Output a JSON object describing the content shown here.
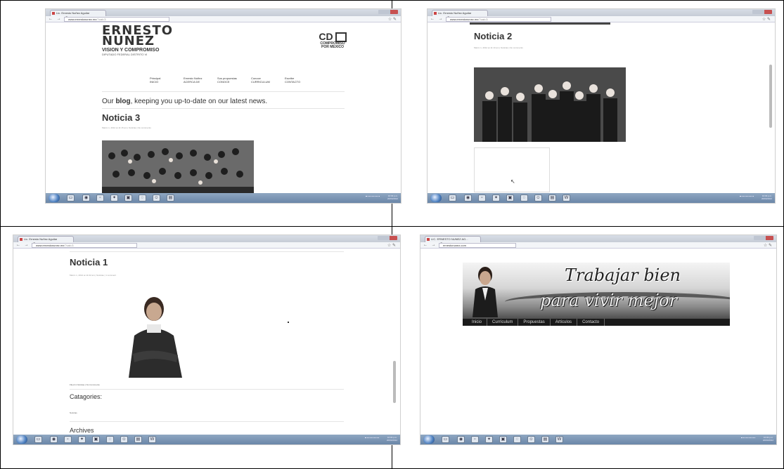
{
  "common": {
    "nav_buttons": "← → C",
    "tools": "☆ ✎",
    "tray_time": "10:03 p.m.",
    "tray_date": "20/04/2012"
  },
  "shot1": {
    "tab_title": "Lic. Ernesto Nuñez Aguilar",
    "url": "www.ernestonunez.mx",
    "url_path": "/?cat=3",
    "logo_top": "ERNESTO",
    "logo_mid": "NUNEZ",
    "logo_slogan": "VISION Y COMPROMISO",
    "logo_sub": "DIPUTADO FEDERAL DISTRITO VI",
    "party_marks": "CD",
    "party_line1": "COMPROMISO",
    "party_line2": "POR MEXICO",
    "menu": [
      {
        "top": "Principal",
        "bottom": "INICIO"
      },
      {
        "top": "Ernesto Nuñez",
        "bottom": "ACERCA DE"
      },
      {
        "top": "Sus propuestas",
        "bottom": "CONOCE"
      },
      {
        "top": "Conoce",
        "bottom": "CURRICULUM"
      },
      {
        "top": "Escribe",
        "bottom": "CONTACTO"
      }
    ],
    "blog_prefix": "Our ",
    "blog_bold": "blog",
    "blog_suffix": ", keeping you up-to-date on our latest news.",
    "post_title": "Noticia 3",
    "post_meta": "Marzo 1, 2012 at 11:15 am | Noticias | No comments"
  },
  "shot2": {
    "tab_title": "Lic. Ernesto Nuñez Aguilar",
    "url": "www.ernestonunez.mx",
    "url_path": "/?cat=3",
    "post_title": "Noticia 2",
    "post_meta": "Marzo 1, 2012 at 11:10 am | Noticias | No comments",
    "cursor": "↖"
  },
  "shot3": {
    "tab_title": "Lic. Ernesto Nuñez Aguilar",
    "url": "www.ernestonunez.mx",
    "url_path": "/?cat=3",
    "post_title": "Noticia 1",
    "post_meta": "Marzo 1, 2012 at 11:02 am | Noticias | 1 comment",
    "filed": "Filed in Noticias | No Comments",
    "categories": "Catagories:",
    "category_item": "Noticias",
    "archives": "Archives"
  },
  "shot4": {
    "tab_title": "LIC. ERNESTO NUNEZ AG...",
    "url": "ernestonunez.com",
    "banner_line1": "Trabajar bien",
    "banner_line2": "para vivir mejor",
    "nav": [
      "Inicio",
      "Currículum",
      "Propuestas",
      "Artículos",
      "Contacto"
    ]
  }
}
